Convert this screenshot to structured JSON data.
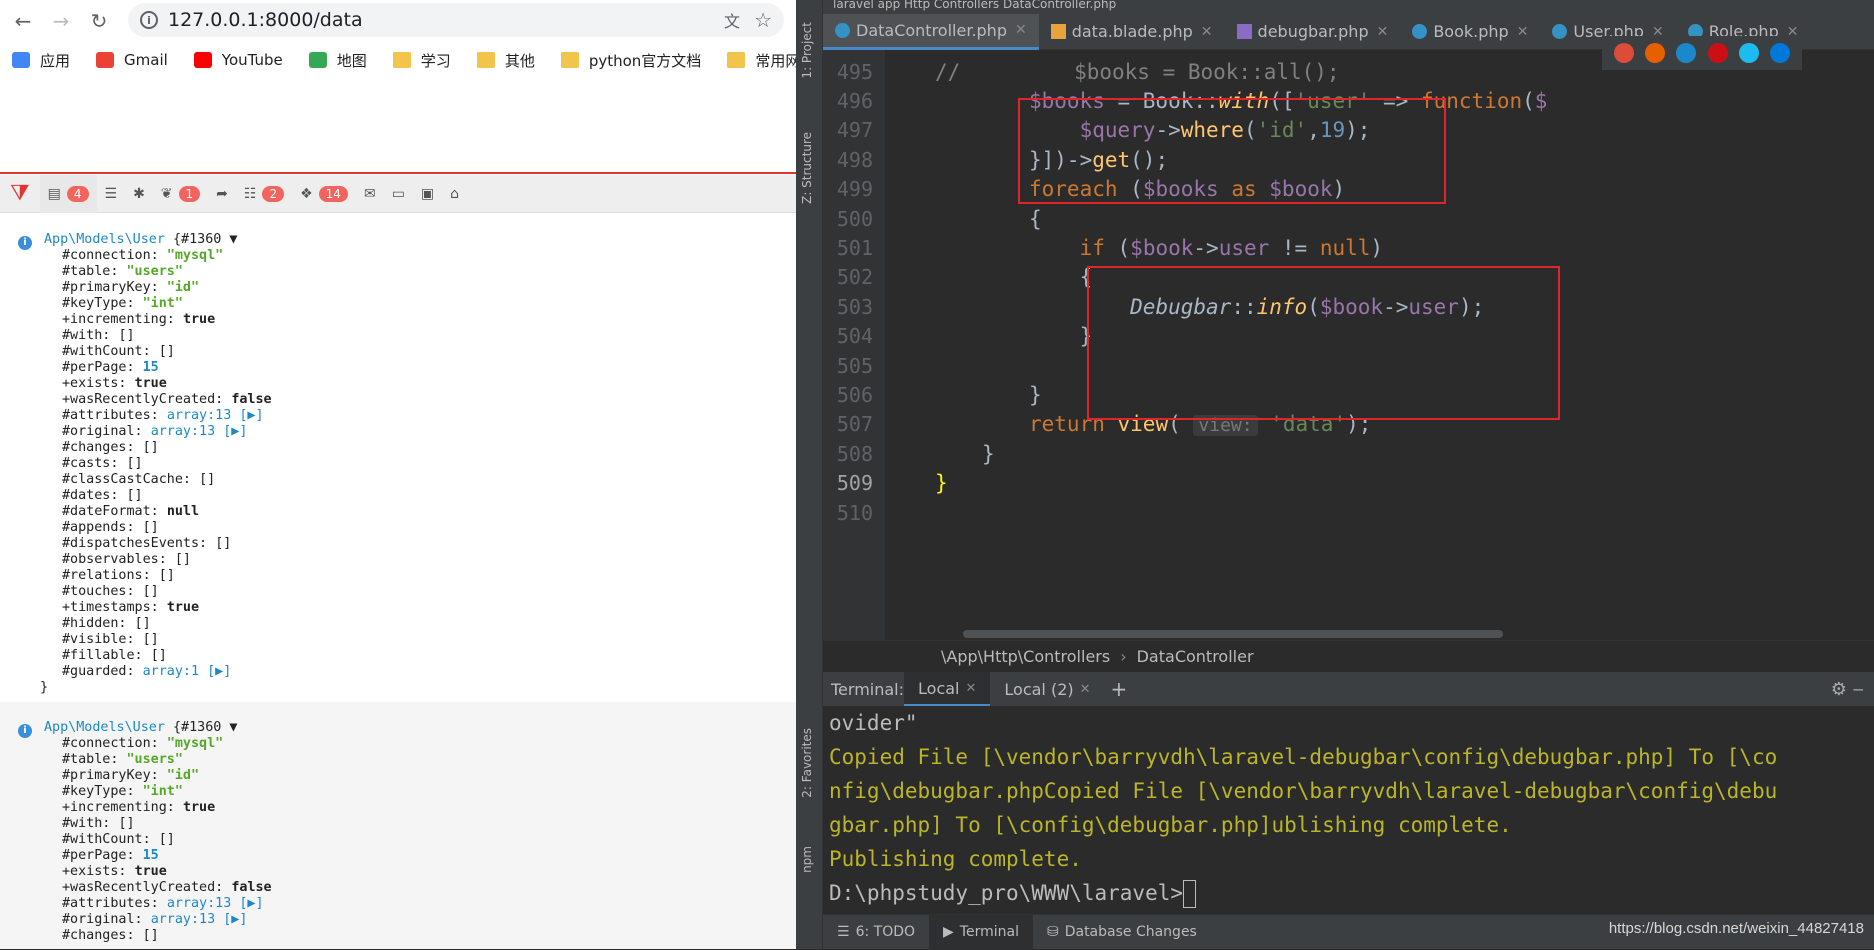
{
  "browser": {
    "url": "127.0.0.1:8000/data",
    "bookmarks": [
      {
        "label": "应用",
        "icon": "apps-grid-icon"
      },
      {
        "label": "Gmail",
        "icon": "gmail-icon"
      },
      {
        "label": "YouTube",
        "icon": "youtube-icon"
      },
      {
        "label": "地图",
        "icon": "maps-icon"
      },
      {
        "label": "学习",
        "icon": "folder-icon"
      },
      {
        "label": "其他",
        "icon": "folder-icon"
      },
      {
        "label": "python官方文档",
        "icon": "folder-icon"
      },
      {
        "label": "常用网站",
        "icon": "folder-icon"
      }
    ]
  },
  "debugbar": {
    "tabs": [
      {
        "badge": "4",
        "icon": "messages-icon"
      },
      {
        "badge": "",
        "icon": "timeline-icon"
      },
      {
        "badge": "",
        "icon": "exceptions-icon"
      },
      {
        "badge": "1",
        "icon": "views-icon"
      },
      {
        "badge": "",
        "icon": "route-icon"
      },
      {
        "badge": "2",
        "icon": "queries-icon"
      },
      {
        "badge": "14",
        "icon": "models-icon"
      },
      {
        "badge": "",
        "icon": "mails-icon"
      },
      {
        "badge": "",
        "icon": "request-icon"
      },
      {
        "badge": "",
        "icon": "session-icon"
      },
      {
        "badge": "",
        "icon": "tags-icon"
      }
    ]
  },
  "dumps": [
    {
      "class": "App\\Models\\User",
      "ref": "{#1360 ▼",
      "props": [
        {
          "k": "#connection: ",
          "v": "\"mysql\"",
          "t": "str"
        },
        {
          "k": "#table: ",
          "v": "\"users\"",
          "t": "str"
        },
        {
          "k": "#primaryKey: ",
          "v": "\"id\"",
          "t": "str"
        },
        {
          "k": "#keyType: ",
          "v": "\"int\"",
          "t": "str"
        },
        {
          "k": "+incrementing: ",
          "v": "true",
          "t": "bool"
        },
        {
          "k": "#with: ",
          "v": "[]",
          "t": "plain"
        },
        {
          "k": "#withCount: ",
          "v": "[]",
          "t": "plain"
        },
        {
          "k": "#perPage: ",
          "v": "15",
          "t": "num"
        },
        {
          "k": "+exists: ",
          "v": "true",
          "t": "bool"
        },
        {
          "k": "+wasRecentlyCreated: ",
          "v": "false",
          "t": "bool"
        },
        {
          "k": "#attributes: ",
          "v": "array:13 [▶]",
          "t": "arr"
        },
        {
          "k": "#original: ",
          "v": "array:13 [▶]",
          "t": "arr"
        },
        {
          "k": "#changes: ",
          "v": "[]",
          "t": "plain"
        },
        {
          "k": "#casts: ",
          "v": "[]",
          "t": "plain"
        },
        {
          "k": "#classCastCache: ",
          "v": "[]",
          "t": "plain"
        },
        {
          "k": "#dates: ",
          "v": "[]",
          "t": "plain"
        },
        {
          "k": "#dateFormat: ",
          "v": "null",
          "t": "bool"
        },
        {
          "k": "#appends: ",
          "v": "[]",
          "t": "plain"
        },
        {
          "k": "#dispatchesEvents: ",
          "v": "[]",
          "t": "plain"
        },
        {
          "k": "#observables: ",
          "v": "[]",
          "t": "plain"
        },
        {
          "k": "#relations: ",
          "v": "[]",
          "t": "plain"
        },
        {
          "k": "#touches: ",
          "v": "[]",
          "t": "plain"
        },
        {
          "k": "+timestamps: ",
          "v": "true",
          "t": "bool"
        },
        {
          "k": "#hidden: ",
          "v": "[]",
          "t": "plain"
        },
        {
          "k": "#visible: ",
          "v": "[]",
          "t": "plain"
        },
        {
          "k": "#fillable: ",
          "v": "[]",
          "t": "plain"
        },
        {
          "k": "#guarded: ",
          "v": "array:1 [▶]",
          "t": "arr"
        }
      ],
      "close": "}"
    },
    {
      "class": "App\\Models\\User",
      "ref": "{#1360 ▼",
      "props": [
        {
          "k": "#connection: ",
          "v": "\"mysql\"",
          "t": "str"
        },
        {
          "k": "#table: ",
          "v": "\"users\"",
          "t": "str"
        },
        {
          "k": "#primaryKey: ",
          "v": "\"id\"",
          "t": "str"
        },
        {
          "k": "#keyType: ",
          "v": "\"int\"",
          "t": "str"
        },
        {
          "k": "+incrementing: ",
          "v": "true",
          "t": "bool"
        },
        {
          "k": "#with: ",
          "v": "[]",
          "t": "plain"
        },
        {
          "k": "#withCount: ",
          "v": "[]",
          "t": "plain"
        },
        {
          "k": "#perPage: ",
          "v": "15",
          "t": "num"
        },
        {
          "k": "+exists: ",
          "v": "true",
          "t": "bool"
        },
        {
          "k": "+wasRecentlyCreated: ",
          "v": "false",
          "t": "bool"
        },
        {
          "k": "#attributes: ",
          "v": "array:13 [▶]",
          "t": "arr"
        },
        {
          "k": "#original: ",
          "v": "array:13 [▶]",
          "t": "arr"
        },
        {
          "k": "#changes: ",
          "v": "[]",
          "t": "plain"
        }
      ],
      "close": ""
    }
  ],
  "ide": {
    "top_crumb": "laravel  app  Http  Controllers  DataController.php",
    "side_labels": [
      "1: Project",
      "Z: Structure",
      "2: Favorites",
      "npm"
    ],
    "tabs": [
      {
        "label": "DataController.php",
        "kind": "class",
        "active": true
      },
      {
        "label": "data.blade.php",
        "kind": "blade",
        "active": false
      },
      {
        "label": "debugbar.php",
        "kind": "php",
        "active": false
      },
      {
        "label": "Book.php",
        "kind": "class",
        "active": false
      },
      {
        "label": "User.php",
        "kind": "class",
        "active": false
      },
      {
        "label": "Role.php",
        "kind": "class",
        "active": false
      }
    ],
    "code_lines": [
      {
        "n": "495",
        "html": "<span class=\"cm\">//         $books = Book::all();</span>"
      },
      {
        "n": "496",
        "html": "<span class=\"var\">$books</span> = Book::<span class=\"fn it\">with</span>([<span class=\"s\">'user'</span> => <span class=\"kw\">function</span>(<span class=\"var\">$</span>"
      },
      {
        "n": "497",
        "html": "    <span class=\"var\">$query</span>-><span class=\"fn\">where</span>(<span class=\"s\">'id'</span>,<span class=\"n\">19</span>);"
      },
      {
        "n": "498",
        "html": "}])-><span class=\"fn\">get</span>();"
      },
      {
        "n": "499",
        "html": "<span class=\"kw\">foreach</span> (<span class=\"var\">$books</span> <span class=\"kw\">as</span> <span class=\"var\">$book</span>)"
      },
      {
        "n": "500",
        "html": "{"
      },
      {
        "n": "501",
        "html": "    <span class=\"kw\">if</span> (<span class=\"var\">$book</span>-><span class=\"var\">user</span> != <span class=\"kw\">null</span>)"
      },
      {
        "n": "502",
        "html": "    {"
      },
      {
        "n": "503",
        "html": "        <span class=\"it\">Debugbar</span>::<span class=\"fn it\">info</span>(<span class=\"var\">$book</span>-><span class=\"var\">user</span>);"
      },
      {
        "n": "504",
        "html": "    }"
      },
      {
        "n": "505",
        "html": ""
      },
      {
        "n": "506",
        "html": "}"
      },
      {
        "n": "507",
        "html": "<span class=\"kw\">return</span> <span class=\"fn\">view</span>( <span class=\"hint\">view:</span> <span class=\"s\">'data'</span>);"
      },
      {
        "n": "508",
        "html": "}"
      },
      {
        "n": "509",
        "html": "<span style=\"color:#ffef28\">}</span>"
      },
      {
        "n": "510",
        "html": ""
      }
    ],
    "breadcrumb": [
      "\\App\\Http\\Controllers",
      "DataController"
    ],
    "terminal": {
      "label": "Terminal:",
      "tabs": [
        "Local",
        "Local (2)"
      ],
      "lines": [
        {
          "text": "ovider\"",
          "cls": ""
        },
        {
          "text": "Copied File [\\vendor\\barryvdh\\laravel-debugbar\\config\\debugbar.php] To [\\co",
          "cls": "tyel"
        },
        {
          "text": "nfig\\debugbar.phpCopied File [\\vendor\\barryvdh\\laravel-debugbar\\config\\debu",
          "cls": "tyel"
        },
        {
          "text": "gbar.php] To [\\config\\debugbar.php]ublishing complete.",
          "cls": "tyel"
        },
        {
          "text": "Publishing complete.",
          "cls": "tyel"
        }
      ],
      "prompt": "D:\\phpstudy_pro\\WWW\\laravel>"
    },
    "status": [
      {
        "label": "6: TODO",
        "icon": "todo-icon",
        "active": false
      },
      {
        "label": "Terminal",
        "icon": "terminal-icon",
        "active": true
      },
      {
        "label": "Database Changes",
        "icon": "database-icon",
        "active": false
      }
    ],
    "watermark": "https://blog.csdn.net/weixin_44827418"
  }
}
